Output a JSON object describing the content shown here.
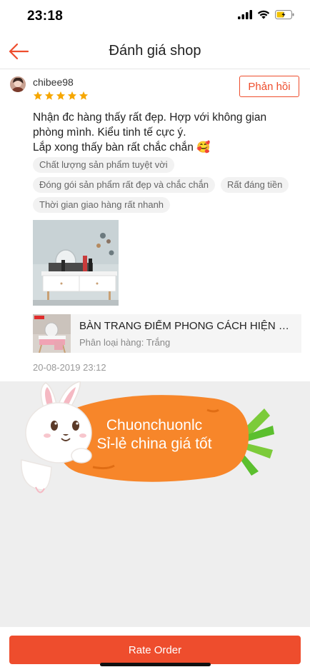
{
  "status_bar": {
    "time": "23:18"
  },
  "header": {
    "title": "Đánh giá shop"
  },
  "review": {
    "username": "chibee98",
    "rating": 5,
    "reply_label": "Phản hồi",
    "comment_line1": "Nhận đc hàng thấy rất đẹp. Hợp với không gian phòng mình. Kiểu tinh tế cực ý.",
    "comment_line2": "Lắp xong thấy bàn rất chắc chắn 🥰",
    "tags": [
      "Chất lượng sản phẩm tuyệt vời",
      "Đóng gói sản phẩm rất đẹp và chắc chắn",
      "Rất đáng tiền",
      "Thời gian giao hàng rất nhanh"
    ],
    "product": {
      "name": "BÀN TRANG ĐIỂM PHONG CÁCH HIỆN ĐẠI",
      "variant": "Phân loại hàng: Trắng"
    },
    "date": "20-08-2019 23:12"
  },
  "banner": {
    "line1": "Chuonchuonlc",
    "line2": "Sỉ-lẻ china giá tốt"
  },
  "footer": {
    "rate_label": "Rate Order"
  },
  "colors": {
    "accent": "#ee4d2d",
    "carrot": "#f7862a",
    "leaf": "#5bbf2e",
    "star": "#f6a700"
  },
  "icons": [
    "back-arrow-icon",
    "signal-icon",
    "wifi-icon",
    "battery-icon",
    "star-icon"
  ]
}
